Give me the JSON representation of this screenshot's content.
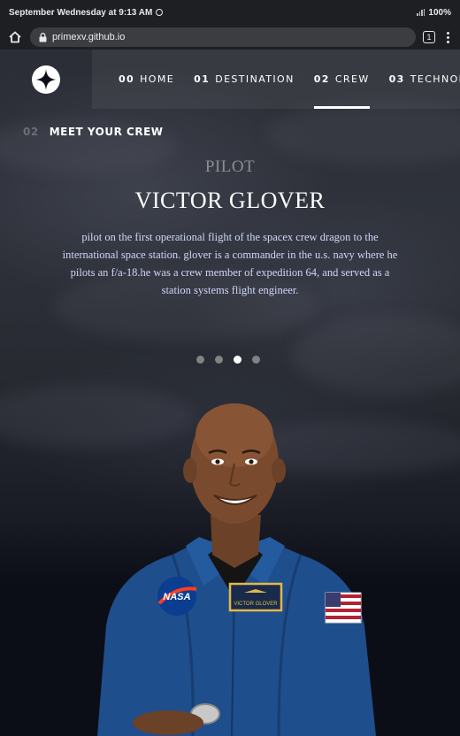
{
  "status": {
    "time_text": "September Wednesday at 9:13 AM",
    "battery": "100%"
  },
  "browser": {
    "url": "primexv.github.io",
    "tab_count": "1"
  },
  "nav": {
    "items": [
      {
        "num": "00",
        "label": "HOME"
      },
      {
        "num": "01",
        "label": "DESTINATION"
      },
      {
        "num": "02",
        "label": "CREW"
      },
      {
        "num": "03",
        "label": "TECHNOLOGY"
      }
    ],
    "active_index": 2
  },
  "crew": {
    "section_num": "02",
    "section_title": "MEET YOUR CREW",
    "role": "PILOT",
    "name": "VICTOR GLOVER",
    "bio": "pilot on the first operational flight of the spacex crew dragon to the international space station. glover is a commander in the u.s. navy where he pilots an f/a-18.he was a crew member of expedition 64, and served as a station systems flight engineer.",
    "slide_count": 4,
    "active_slide": 2,
    "patch_name": "VICTOR GLOVER",
    "nasa_text": "NASA"
  },
  "colors": {
    "background": "#0b0d17",
    "accent": "#d0d6f9",
    "muted": "#8b8d93",
    "suit": "#1f4e8c"
  }
}
